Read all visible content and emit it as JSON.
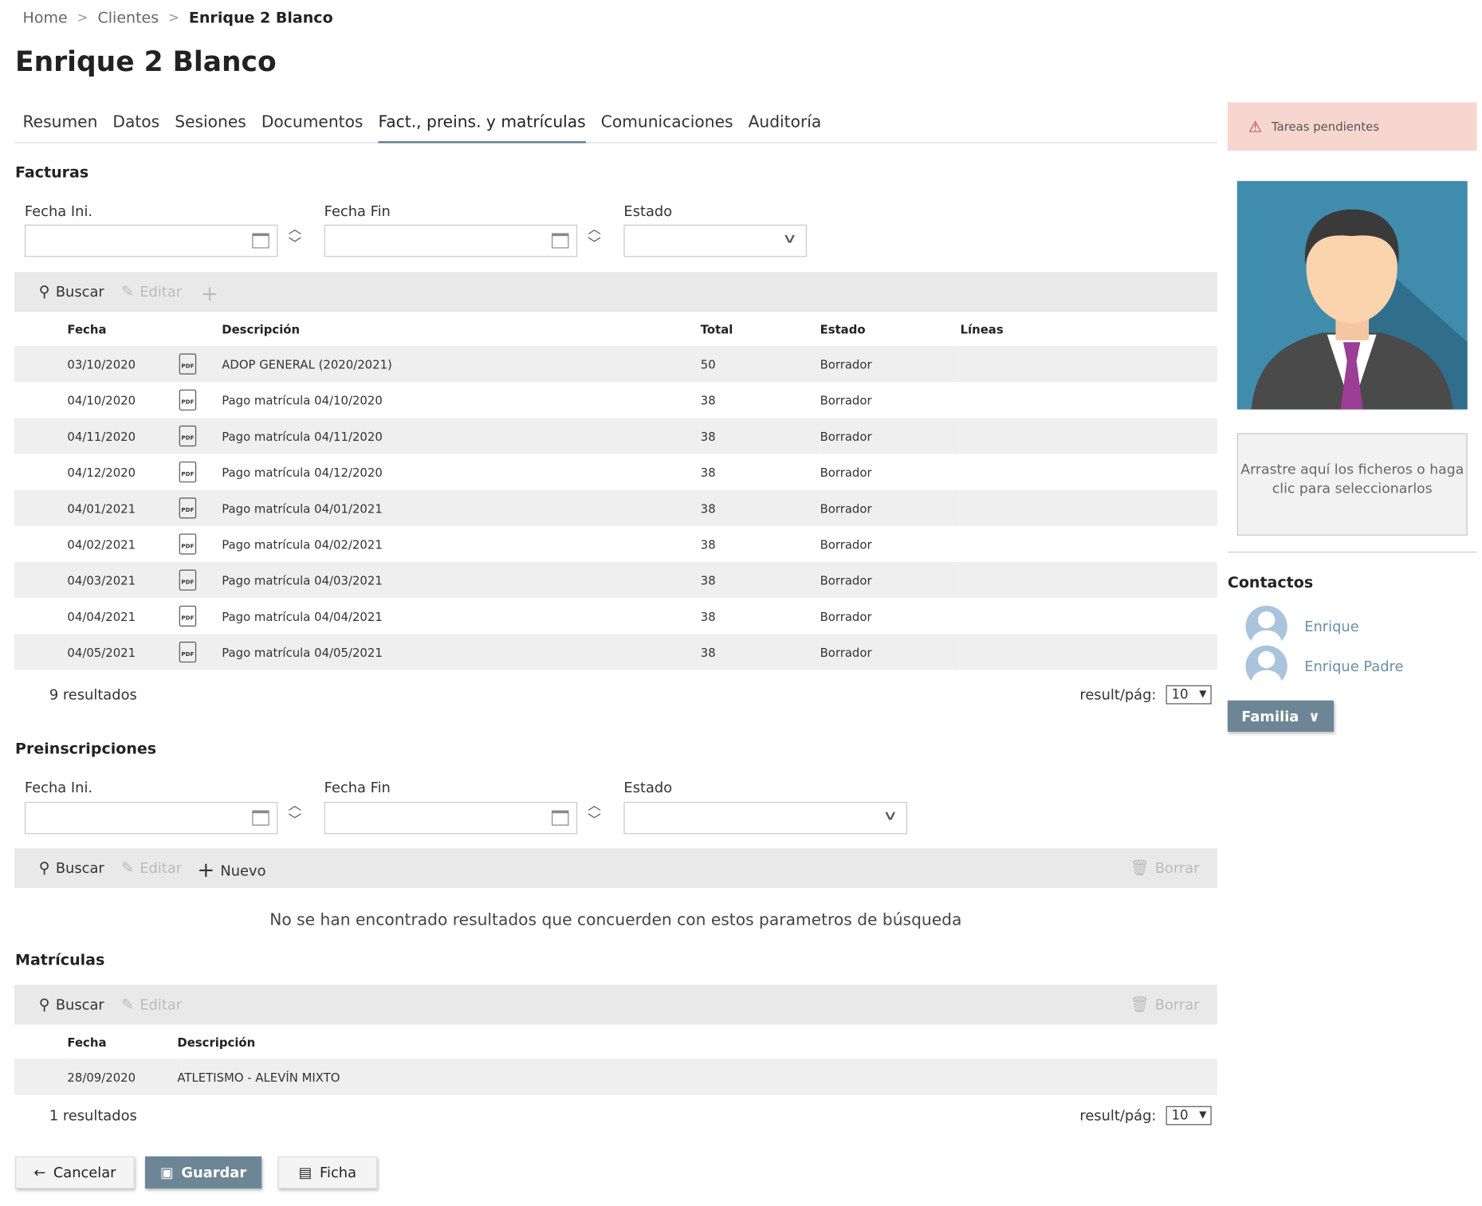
{
  "breadcrumb": {
    "home": "Home",
    "clientes": "Clientes",
    "current": "Enrique 2 Blanco"
  },
  "title": "Enrique 2 Blanco",
  "tabs": [
    "Resumen",
    "Datos",
    "Sesiones",
    "Documentos",
    "Fact., preins. y matrículas",
    "Comunicaciones",
    "Auditoría"
  ],
  "active_tab": "Fact., preins. y matrículas",
  "facturas": {
    "title": "Facturas",
    "fecha_ini_label": "Fecha Ini.",
    "fecha_fin_label": "Fecha Fin",
    "estado_label": "Estado",
    "toolbar": {
      "buscar": "Buscar",
      "editar": "Editar"
    },
    "headers": {
      "fecha": "Fecha",
      "descripcion": "Descripción",
      "total": "Total",
      "estado": "Estado",
      "lineas": "Líneas"
    },
    "rows": [
      {
        "fecha": "03/10/2020",
        "descripcion": "ADOP GENERAL (2020/2021)",
        "total": "50",
        "estado": "Borrador"
      },
      {
        "fecha": "04/10/2020",
        "descripcion": "Pago matrícula 04/10/2020",
        "total": "38",
        "estado": "Borrador"
      },
      {
        "fecha": "04/11/2020",
        "descripcion": "Pago matrícula 04/11/2020",
        "total": "38",
        "estado": "Borrador"
      },
      {
        "fecha": "04/12/2020",
        "descripcion": "Pago matrícula 04/12/2020",
        "total": "38",
        "estado": "Borrador"
      },
      {
        "fecha": "04/01/2021",
        "descripcion": "Pago matrícula 04/01/2021",
        "total": "38",
        "estado": "Borrador"
      },
      {
        "fecha": "04/02/2021",
        "descripcion": "Pago matrícula 04/02/2021",
        "total": "38",
        "estado": "Borrador"
      },
      {
        "fecha": "04/03/2021",
        "descripcion": "Pago matrícula 04/03/2021",
        "total": "38",
        "estado": "Borrador"
      },
      {
        "fecha": "04/04/2021",
        "descripcion": "Pago matrícula 04/04/2021",
        "total": "38",
        "estado": "Borrador"
      },
      {
        "fecha": "04/05/2021",
        "descripcion": "Pago matrícula 04/05/2021",
        "total": "38",
        "estado": "Borrador"
      }
    ],
    "pdf_label": "PDF",
    "count": "9 resultados",
    "rpp_label": "result/pág:",
    "rpp_value": "10"
  },
  "preinscripciones": {
    "title": "Preinscripciones",
    "fecha_ini_label": "Fecha Ini.",
    "fecha_fin_label": "Fecha Fin",
    "estado_label": "Estado",
    "toolbar": {
      "buscar": "Buscar",
      "editar": "Editar",
      "nuevo": "Nuevo",
      "borrar": "Borrar"
    },
    "empty": "No se han encontrado resultados que concuerden con estos parametros de búsqueda"
  },
  "matriculas": {
    "title": "Matrículas",
    "toolbar": {
      "buscar": "Buscar",
      "editar": "Editar",
      "borrar": "Borrar"
    },
    "headers": {
      "fecha": "Fecha",
      "descripcion": "Descripción"
    },
    "rows": [
      {
        "fecha": "28/09/2020",
        "descripcion": "ATLETISMO - ALEVÍN MIXTO"
      }
    ],
    "count": "1 resultados",
    "rpp_label": "result/pág:",
    "rpp_value": "10"
  },
  "buttons": {
    "cancelar": "Cancelar",
    "guardar": "Guardar",
    "ficha": "Ficha"
  },
  "sidebar": {
    "alert": "Tareas pendientes",
    "drop_text": "Arrastre aquí los ficheros o haga clic para seleccionarlos",
    "contactos_title": "Contactos",
    "contacts": [
      "Enrique",
      "Enrique Padre"
    ],
    "familia": "Familia"
  },
  "colors": {
    "accent": "#6d8695",
    "alert_bg": "#f7d6cf",
    "link": "#6a8fa8",
    "avatar_bg": "#3f8cad"
  }
}
